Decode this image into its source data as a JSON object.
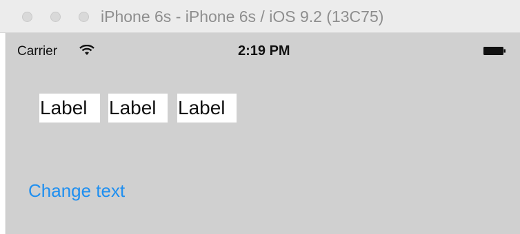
{
  "window": {
    "title": "iPhone 6s - iPhone 6s / iOS 9.2 (13C75)"
  },
  "status_bar": {
    "carrier": "Carrier",
    "time": "2:19 PM",
    "wifi_icon": "wifi-icon",
    "battery_icon": "battery-full-icon"
  },
  "labels": [
    "Label",
    "Label",
    "Label"
  ],
  "button": {
    "label": "Change text"
  },
  "colors": {
    "titlebar_bg": "#ececec",
    "screen_bg": "#d0d0d0",
    "label_bg": "#ffffff",
    "button_tint": "#1f8ff0"
  }
}
